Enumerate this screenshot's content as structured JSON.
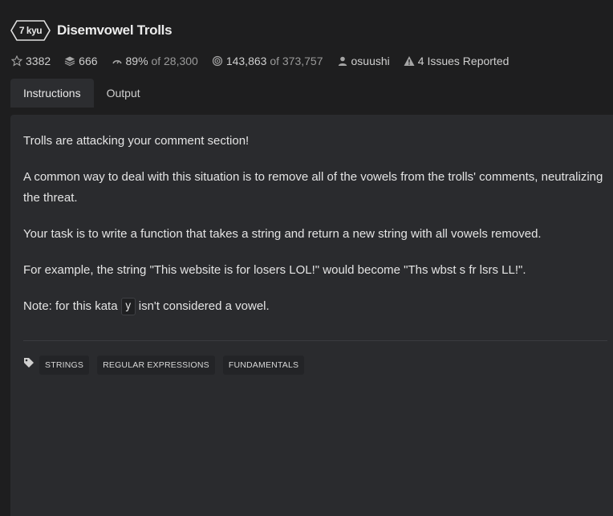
{
  "kata": {
    "rank": "7 kyu",
    "title": "Disemvowel Trolls"
  },
  "stats": {
    "stars": "3382",
    "collections": "666",
    "satisfaction": "89%",
    "satisfaction_of": "of 28,300",
    "completions": "143,863",
    "completions_of": "of 373,757",
    "author": "osuushi",
    "issues": "4 Issues Reported"
  },
  "tabs": [
    {
      "label": "Instructions",
      "active": true
    },
    {
      "label": "Output",
      "active": false
    }
  ],
  "description": {
    "p1": "Trolls are attacking your comment section!",
    "p2": "A common way to deal with this situation is to remove all of the vowels from the trolls' comments, neutralizing the threat.",
    "p3": "Your task is to write a function that takes a string and return a new string with all vowels removed.",
    "p4": "For example, the string \"This website is for losers LOL!\" would become \"Ths wbst s fr lsrs LL!\".",
    "p5_before": "Note: for this kata",
    "p5_code": "y",
    "p5_after": "isn't considered a vowel."
  },
  "tags": [
    "STRINGS",
    "REGULAR EXPRESSIONS",
    "FUNDAMENTALS"
  ],
  "icons": {
    "star": "star-icon",
    "collections": "layers-icon",
    "satisfaction": "gauge-icon",
    "completions": "target-icon",
    "author": "user-icon",
    "issues": "warning-icon",
    "tags": "tag-icon"
  }
}
